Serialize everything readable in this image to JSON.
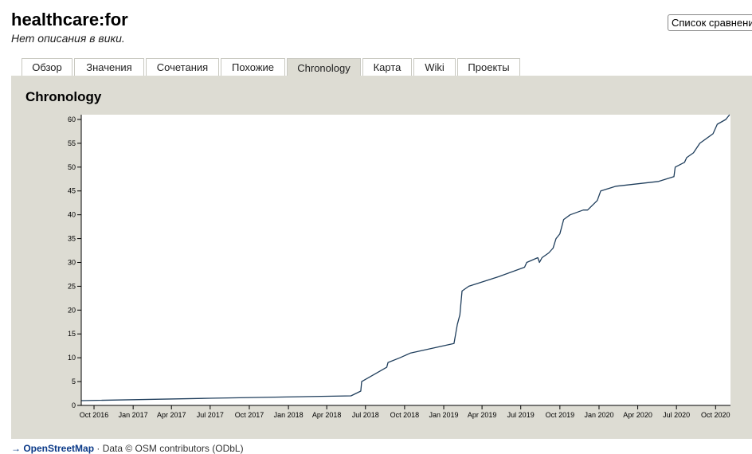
{
  "header": {
    "title": "healthcare:for",
    "description": "Нет описания в вики.",
    "compare_button": "Список сравнени"
  },
  "tabs": [
    {
      "label": "Обзор",
      "active": false
    },
    {
      "label": "Значения",
      "active": false
    },
    {
      "label": "Сочетания",
      "active": false
    },
    {
      "label": "Похожие",
      "active": false
    },
    {
      "label": "Chronology",
      "active": true
    },
    {
      "label": "Карта",
      "active": false
    },
    {
      "label": "Wiki",
      "active": false
    },
    {
      "label": "Проекты",
      "active": false
    }
  ],
  "panel": {
    "title": "Chronology"
  },
  "footer": {
    "arrow": "→",
    "osm_link": "OpenStreetMap",
    "data_text": " · Data © OSM contributors (ODbL)"
  },
  "colors": {
    "line": "#1f3e5c",
    "panel_bg": "#dddcd3",
    "plot_bg": "#ffffff"
  },
  "chart_data": {
    "type": "line",
    "title": "",
    "xlabel": "",
    "ylabel": "",
    "ylim": [
      0,
      61
    ],
    "xlim": [
      "2016-09-01",
      "2020-11-05"
    ],
    "yticks": [
      0,
      5,
      10,
      15,
      20,
      25,
      30,
      35,
      40,
      45,
      50,
      55,
      60
    ],
    "xticks": [
      {
        "date": "2016-10-01",
        "label": "Oct 2016"
      },
      {
        "date": "2017-01-01",
        "label": "Jan 2017"
      },
      {
        "date": "2017-04-01",
        "label": "Apr 2017"
      },
      {
        "date": "2017-07-01",
        "label": "Jul 2017"
      },
      {
        "date": "2017-10-01",
        "label": "Oct 2017"
      },
      {
        "date": "2018-01-01",
        "label": "Jan 2018"
      },
      {
        "date": "2018-04-01",
        "label": "Apr 2018"
      },
      {
        "date": "2018-07-01",
        "label": "Jul 2018"
      },
      {
        "date": "2018-10-01",
        "label": "Oct 2018"
      },
      {
        "date": "2019-01-01",
        "label": "Jan 2019"
      },
      {
        "date": "2019-04-01",
        "label": "Apr 2019"
      },
      {
        "date": "2019-07-01",
        "label": "Jul 2019"
      },
      {
        "date": "2019-10-01",
        "label": "Oct 2019"
      },
      {
        "date": "2020-01-01",
        "label": "Jan 2020"
      },
      {
        "date": "2020-04-01",
        "label": "Apr 2020"
      },
      {
        "date": "2020-07-01",
        "label": "Jul 2020"
      },
      {
        "date": "2020-10-01",
        "label": "Oct 2020"
      }
    ],
    "series": [
      {
        "points": [
          [
            "2016-09-02",
            1
          ],
          [
            "2017-07-01",
            1.5
          ],
          [
            "2018-05-28",
            2
          ],
          [
            "2018-06-20",
            3
          ],
          [
            "2018-06-22",
            5
          ],
          [
            "2018-08-20",
            8
          ],
          [
            "2018-08-23",
            9
          ],
          [
            "2018-09-20",
            10
          ],
          [
            "2018-10-15",
            11
          ],
          [
            "2019-01-25",
            13
          ],
          [
            "2019-02-02",
            17
          ],
          [
            "2019-02-08",
            19
          ],
          [
            "2019-02-13",
            24
          ],
          [
            "2019-03-01",
            25
          ],
          [
            "2019-05-10",
            27
          ],
          [
            "2019-07-10",
            29
          ],
          [
            "2019-07-15",
            30
          ],
          [
            "2019-08-10",
            31
          ],
          [
            "2019-08-14",
            30
          ],
          [
            "2019-08-20",
            31
          ],
          [
            "2019-09-05",
            32
          ],
          [
            "2019-09-15",
            33
          ],
          [
            "2019-09-22",
            35
          ],
          [
            "2019-10-01",
            36
          ],
          [
            "2019-10-10",
            39
          ],
          [
            "2019-10-25",
            40
          ],
          [
            "2019-11-25",
            41
          ],
          [
            "2019-12-05",
            41
          ],
          [
            "2019-12-28",
            43
          ],
          [
            "2020-01-05",
            45
          ],
          [
            "2020-02-10",
            46
          ],
          [
            "2020-05-20",
            47
          ],
          [
            "2020-06-25",
            48
          ],
          [
            "2020-06-28",
            50
          ],
          [
            "2020-07-20",
            51
          ],
          [
            "2020-07-25",
            52
          ],
          [
            "2020-08-10",
            53
          ],
          [
            "2020-08-25",
            55
          ],
          [
            "2020-09-25",
            57
          ],
          [
            "2020-10-05",
            59
          ],
          [
            "2020-10-25",
            60
          ],
          [
            "2020-11-03",
            61
          ]
        ]
      }
    ]
  }
}
